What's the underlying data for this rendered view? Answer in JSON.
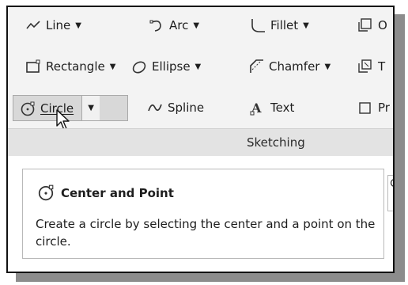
{
  "ribbon": {
    "tools": [
      {
        "label": "Line",
        "icon": "line-icon",
        "has_dropdown": true
      },
      {
        "label": "Arc",
        "icon": "arc-icon",
        "has_dropdown": true
      },
      {
        "label": "Fillet",
        "icon": "fillet-icon",
        "has_dropdown": true
      },
      {
        "label": "O",
        "icon": "offset-icon",
        "has_dropdown": false
      },
      {
        "label": "Rectangle",
        "icon": "rectangle-icon",
        "has_dropdown": true
      },
      {
        "label": "Ellipse",
        "icon": "ellipse-icon",
        "has_dropdown": true
      },
      {
        "label": "Chamfer",
        "icon": "chamfer-icon",
        "has_dropdown": true
      },
      {
        "label": "T",
        "icon": "trim-icon",
        "has_dropdown": false
      },
      {
        "label": "Circle",
        "icon": "circle-icon",
        "has_dropdown": true,
        "active": true
      },
      {
        "label": "Spline",
        "icon": "spline-icon",
        "has_dropdown": false
      },
      {
        "label": "Text",
        "icon": "text-icon",
        "has_dropdown": false
      },
      {
        "label": "Pr",
        "icon": "project-icon",
        "has_dropdown": false
      }
    ],
    "panel_title": "Sketching"
  },
  "tooltip": {
    "title": "Center and Point",
    "description": "Create a circle by selecting the center and a point on the circle."
  },
  "colors": {
    "ribbon_bg": "#f3f3f3",
    "panel_bar_bg": "#e3e3e3",
    "active_button_bg": "#d8d8d8",
    "frame_shadow": "#8c8c8c"
  }
}
